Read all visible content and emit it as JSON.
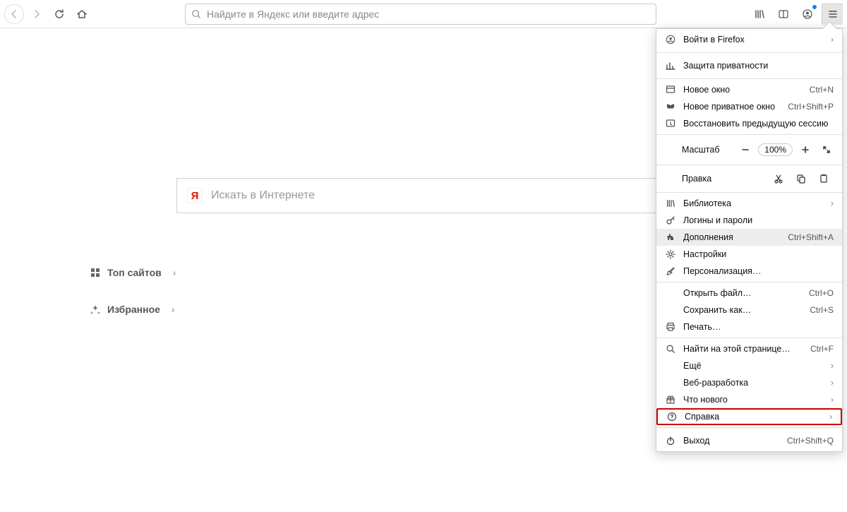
{
  "urlbar": {
    "placeholder": "Найдите в Яндекс или введите адрес"
  },
  "search": {
    "placeholder": "Искать в Интернете"
  },
  "sections": {
    "top_sites": "Топ сайтов",
    "favorites": "Избранное"
  },
  "menu": {
    "sign_in": "Войти в Firefox",
    "privacy": "Защита приватности",
    "new_window": "Новое окно",
    "new_window_sc": "Ctrl+N",
    "new_private": "Новое приватное окно",
    "new_private_sc": "Ctrl+Shift+P",
    "restore_session": "Восстановить предыдущую сессию",
    "zoom_label": "Масштаб",
    "zoom_value": "100%",
    "edit_label": "Правка",
    "library": "Библиотека",
    "logins": "Логины и пароли",
    "addons": "Дополнения",
    "addons_sc": "Ctrl+Shift+A",
    "settings": "Настройки",
    "customize": "Персонализация…",
    "open_file": "Открыть файл…",
    "open_file_sc": "Ctrl+O",
    "save_as": "Сохранить как…",
    "save_as_sc": "Ctrl+S",
    "print": "Печать…",
    "find": "Найти на этой странице…",
    "find_sc": "Ctrl+F",
    "more": "Ещё",
    "webdev": "Веб-разработка",
    "whatsnew": "Что нового",
    "help": "Справка",
    "exit": "Выход",
    "exit_sc": "Ctrl+Shift+Q"
  }
}
